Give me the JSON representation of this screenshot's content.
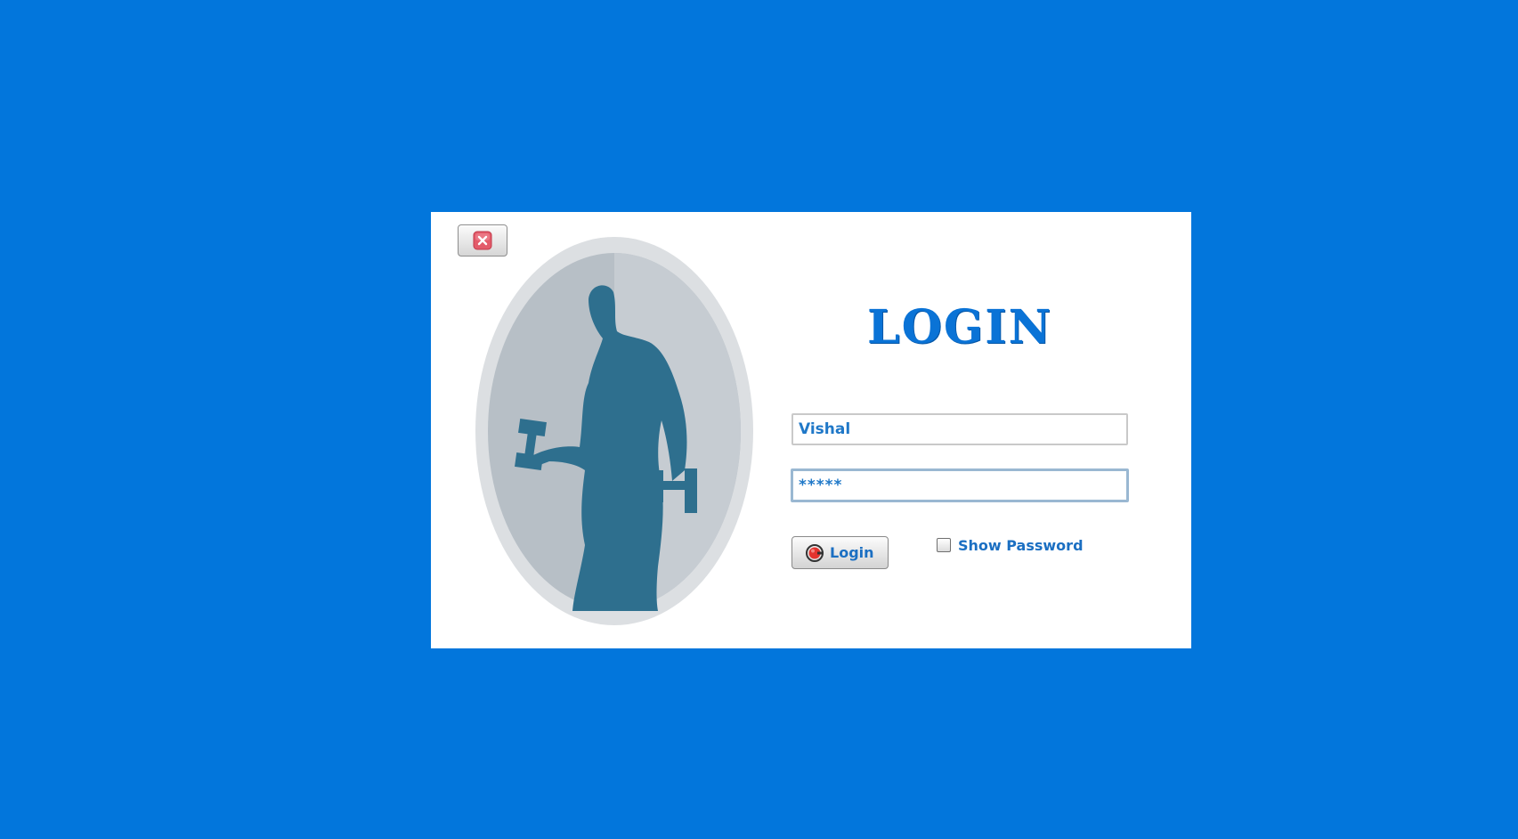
{
  "colors": {
    "background": "#0276dc",
    "panel": "#ffffff",
    "accent_text": "#1b6fc2",
    "title": "#0a73d6",
    "silhouette": "#2e6f8e"
  },
  "close_button": {
    "icon": "close-icon"
  },
  "illustration": {
    "icon": "weightlifter-silhouette-icon"
  },
  "login_title": "LOGIN",
  "username": {
    "value": "Vishal"
  },
  "password": {
    "value": "*****"
  },
  "login_button": {
    "label": "Login",
    "icon": "power-icon"
  },
  "show_password": {
    "label": "Show Password",
    "checked": false
  }
}
